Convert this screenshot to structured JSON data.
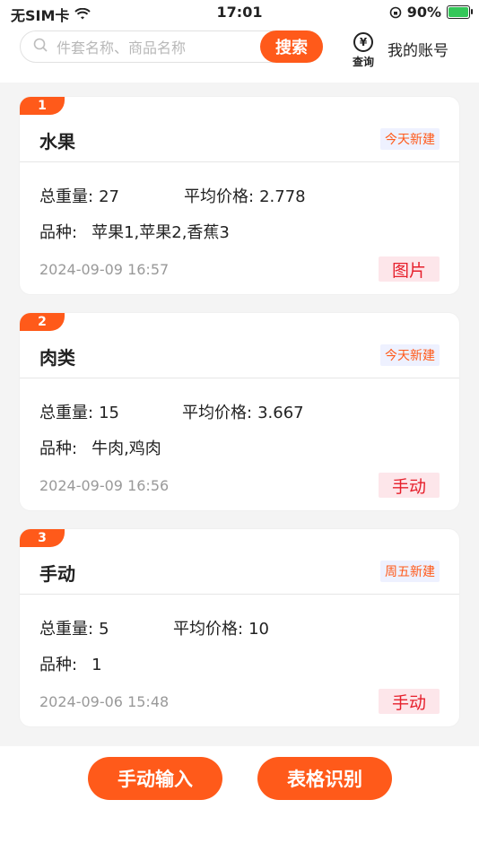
{
  "status_bar": {
    "carrier": "无SIM卡",
    "time": "17:01",
    "battery": "90%",
    "battery_level": 0.9
  },
  "header": {
    "search_placeholder": "件套名称、商品名称",
    "search_button": "搜索",
    "query_label": "查询",
    "query_icon": "yen-icon",
    "account_label": "我的账号"
  },
  "labels": {
    "weight": "总重量:",
    "avg_price": "平均价格:",
    "variety": "品种:"
  },
  "cards": [
    {
      "index": "1",
      "title": "水果",
      "tag": "今天新建",
      "weight": "27",
      "avg_price": "2.778",
      "variety": "苹果1,苹果2,香蕉3",
      "date": "2024-09-09 16:57",
      "method": "图片"
    },
    {
      "index": "2",
      "title": "肉类",
      "tag": "今天新建",
      "weight": "15",
      "avg_price": "3.667",
      "variety": "牛肉,鸡肉",
      "date": "2024-09-09 16:56",
      "method": "手动"
    },
    {
      "index": "3",
      "title": "手动",
      "tag": "周五新建",
      "weight": "5",
      "avg_price": "10",
      "variety": "1",
      "date": "2024-09-06 15:48",
      "method": "手动"
    }
  ],
  "bottom": {
    "manual_input": "手动输入",
    "table_recognition": "表格识别"
  },
  "colors": {
    "accent": "#ff5a1a",
    "method_text": "#e6202c",
    "method_bg": "#fde6ea",
    "tag_bg": "#eef1ff"
  }
}
